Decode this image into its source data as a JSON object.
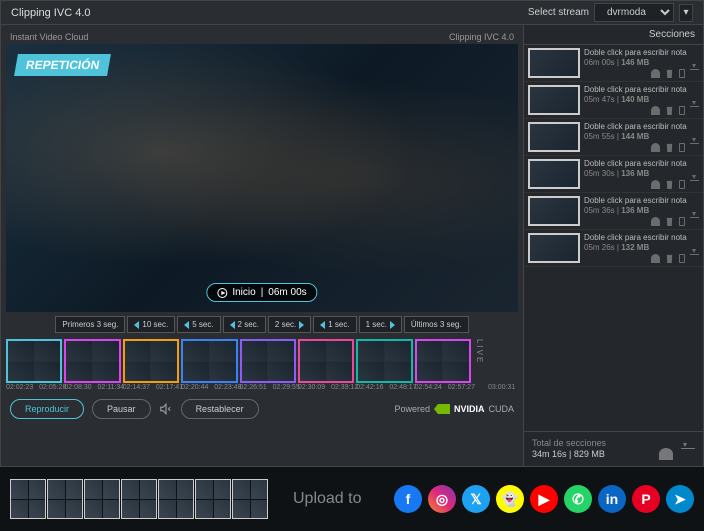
{
  "app_title": "Clipping IVC 4.0",
  "stream_label": "Select stream",
  "stream_value": "dvrmoda",
  "cloud_label": "Instant Video Cloud",
  "video_header_right": "Clipping IVC 4.0",
  "repetition_badge": "REPETICIÓN",
  "pill_label": "Inicio",
  "pill_time": "06m 00s",
  "nav": {
    "first": "Primeros 3 seg.",
    "b10": "10 sec.",
    "b5": "5 sec.",
    "b2": "2 sec.",
    "b1": "1 sec.",
    "last": "Últimos 3 seg."
  },
  "timeline": [
    {
      "t1": "02:02:23",
      "t2": "02:05:28",
      "color": "c-cyan"
    },
    {
      "t1": "02:08:30",
      "t2": "02:11:34",
      "color": "c-mag"
    },
    {
      "t1": "02:14:37",
      "t2": "02:17:41",
      "color": "c-org"
    },
    {
      "t1": "02:20:44",
      "t2": "02:23:48",
      "color": "c-blue"
    },
    {
      "t1": "02:26:51",
      "t2": "02:29:55",
      "color": "c-pur"
    },
    {
      "t1": "02:30:09",
      "t2": "02:39:12",
      "color": "c-pink"
    },
    {
      "t1": "02:42:16",
      "t2": "02:48:17",
      "color": "c-teal"
    },
    {
      "t1": "02:54:24",
      "t2": "02:57:27",
      "color": "c-mag"
    }
  ],
  "timeline_end": "03:00:31",
  "live_label": "LIVE",
  "controls": {
    "play": "Reproducir",
    "pause": "Pausar",
    "reset": "Restablecer"
  },
  "powered": "Powered",
  "nvidia": "NVIDIA",
  "cuda": "CUDA",
  "sections_title": "Secciones",
  "sections": [
    {
      "note": "Doble click para escribir nota",
      "time": "06m 00s",
      "size": "146 MB",
      "color": "c-cyan"
    },
    {
      "note": "Doble click para escribir nota",
      "time": "05m 47s",
      "size": "140 MB",
      "color": "c-org"
    },
    {
      "note": "Doble click para escribir nota",
      "time": "05m 55s",
      "size": "144 MB",
      "color": "c-blue"
    },
    {
      "note": "Doble click para escribir nota",
      "time": "05m 30s",
      "size": "136 MB",
      "color": "c-pur"
    },
    {
      "note": "Doble click para escribir nota",
      "time": "05m 36s",
      "size": "136 MB",
      "color": "c-pink"
    },
    {
      "note": "Doble click para escribir nota",
      "time": "05m 26s",
      "size": "132 MB",
      "color": "c-mag"
    }
  ],
  "totals": {
    "label": "Total de secciones",
    "time": "34m 16s",
    "size": "829 MB"
  },
  "upload_label": "Upload to",
  "socials": [
    {
      "name": "facebook",
      "cls": "fb",
      "glyph": "f"
    },
    {
      "name": "instagram",
      "cls": "ig",
      "glyph": "◎"
    },
    {
      "name": "twitter",
      "cls": "tw",
      "glyph": "𝕏"
    },
    {
      "name": "snapchat",
      "cls": "sc",
      "glyph": "👻"
    },
    {
      "name": "youtube",
      "cls": "yt",
      "glyph": "▶"
    },
    {
      "name": "whatsapp",
      "cls": "wa",
      "glyph": "✆"
    },
    {
      "name": "linkedin",
      "cls": "li",
      "glyph": "in"
    },
    {
      "name": "pinterest",
      "cls": "pi",
      "glyph": "P"
    },
    {
      "name": "telegram",
      "cls": "tg",
      "glyph": "➤"
    }
  ],
  "footer_strips": [
    "c-cyan",
    "c-mag",
    "c-org",
    "c-blue",
    "c-pur",
    "c-pink",
    "c-teal"
  ]
}
